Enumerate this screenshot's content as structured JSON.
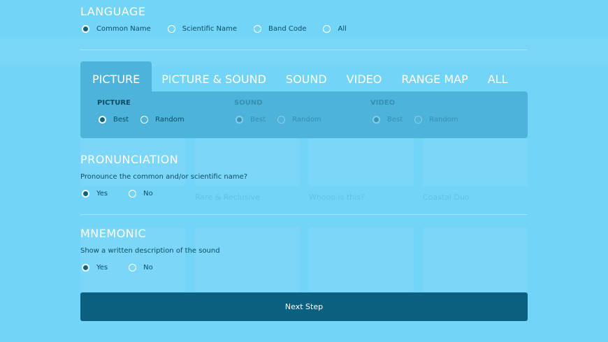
{
  "language": {
    "title": "LANGUAGE",
    "options": [
      {
        "label": "Common Name",
        "checked": true
      },
      {
        "label": "Scientific Name",
        "checked": false
      },
      {
        "label": "Band Code",
        "checked": false
      },
      {
        "label": "All",
        "checked": false
      }
    ]
  },
  "media_tabs": {
    "tabs": [
      {
        "label": "PICTURE",
        "active": true
      },
      {
        "label": "PICTURE & SOUND",
        "active": false
      },
      {
        "label": "SOUND",
        "active": false
      },
      {
        "label": "VIDEO",
        "active": false
      },
      {
        "label": "RANGE MAP",
        "active": false
      },
      {
        "label": "ALL",
        "active": false
      }
    ],
    "panel": {
      "columns": [
        {
          "title": "PICTURE",
          "enabled": true,
          "options": [
            {
              "label": "Best",
              "checked": true
            },
            {
              "label": "Random",
              "checked": false
            }
          ]
        },
        {
          "title": "SOUND",
          "enabled": false,
          "options": [
            {
              "label": "Best",
              "checked": true
            },
            {
              "label": "Random",
              "checked": false
            }
          ]
        },
        {
          "title": "VIDEO",
          "enabled": false,
          "options": [
            {
              "label": "Best",
              "checked": true
            },
            {
              "label": "Random",
              "checked": false
            }
          ]
        }
      ]
    }
  },
  "pronunciation": {
    "title": "PRONUNCIATION",
    "question": "Pronounce the common and/or scientific name?",
    "options": [
      {
        "label": "Yes",
        "checked": true
      },
      {
        "label": "No",
        "checked": false
      }
    ]
  },
  "mnemonic": {
    "title": "MNEMONIC",
    "question": "Show a written description of the sound",
    "options": [
      {
        "label": "Yes",
        "checked": true
      },
      {
        "label": "No",
        "checked": false
      }
    ]
  },
  "next_button": {
    "label": "Next Step"
  },
  "background": {
    "captions": [
      "Rare & Reclusive",
      "Whooo is this?",
      "Coastal Duo"
    ],
    "colors": {
      "page_bg": "#72d4f7",
      "panel_bg": "#4db3da",
      "button_bg": "#0b6080",
      "text": "#0b4d66"
    }
  }
}
